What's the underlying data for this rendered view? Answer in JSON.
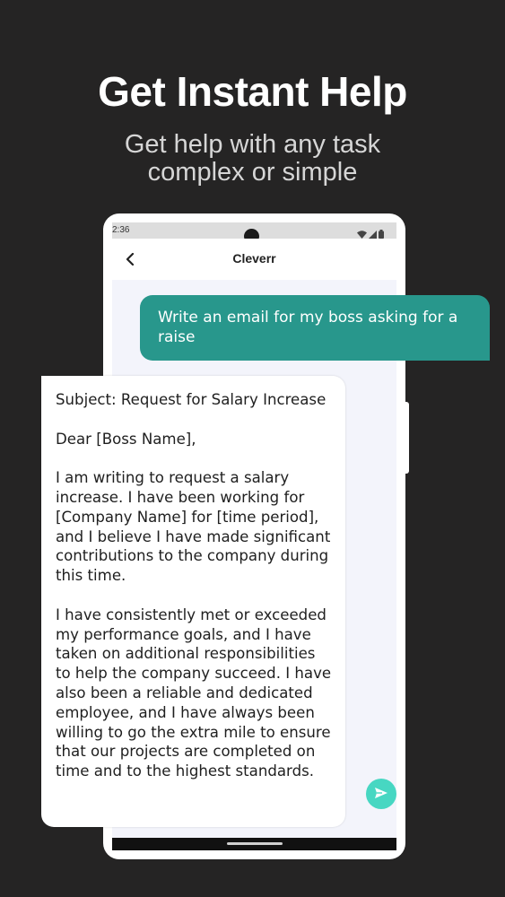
{
  "promo": {
    "headline": "Get Instant Help",
    "subline_1": "Get help with any task",
    "subline_2": "complex or simple"
  },
  "status_bar": {
    "time": "2:36",
    "icons": [
      "wifi-icon",
      "signal-icon",
      "battery-icon"
    ]
  },
  "app_bar": {
    "title": "Cleverr",
    "back_icon": "chevron-left-icon"
  },
  "chat": {
    "user_message": "Write an email for my boss asking for a raise",
    "reply": {
      "subject": "Subject: Request for Salary Increase",
      "greeting": "Dear [Boss Name],",
      "paragraph_1": "I am writing to request a salary increase. I have been working for [Company Name] for [time period], and I believe I have made significant contributions to the company during this time.",
      "paragraph_2": "I have consistently met or exceeded my performance goals, and I have taken on additional responsibilities to help the company succeed. I have also been a reliable and dedicated employee, and I have always been willing to go the extra mile to ensure that our projects are completed on time and to the highest standards."
    }
  },
  "composer": {
    "send_icon": "send-icon"
  },
  "colors": {
    "background": "#252424",
    "user_bubble": "#28978c",
    "send_button": "#47d7c2",
    "screen_background": "#f3f4fb"
  }
}
